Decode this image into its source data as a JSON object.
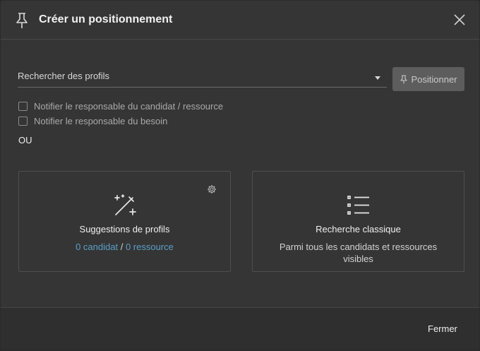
{
  "dialog": {
    "title": "Créer un positionnement",
    "header_icon": "pin-icon",
    "close_icon": "close-icon"
  },
  "search": {
    "placeholder": "Rechercher des profils",
    "value": ""
  },
  "position_button": {
    "label": "Positionner",
    "icon": "pin-icon"
  },
  "checkboxes": [
    {
      "label": "Notifier le responsable du candidat / ressource",
      "checked": false
    },
    {
      "label": "Notifier le responsable du besoin",
      "checked": false
    }
  ],
  "or_label": "OU",
  "cards": {
    "suggestions": {
      "icon": "magic-wand-icon",
      "settings_icon": "gear-icon",
      "title": "Suggestions de profils",
      "candidates_link": "0 candidat",
      "separator": "/",
      "resources_link": "0 ressource"
    },
    "classic": {
      "icon": "list-icon",
      "title": "Recherche classique",
      "subtitle": "Parmi tous les candidats et ressources visibles"
    }
  },
  "footer": {
    "close_label": "Fermer"
  }
}
